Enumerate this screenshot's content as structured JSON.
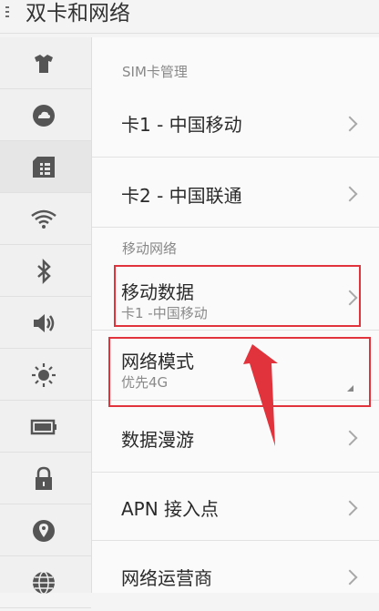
{
  "header": {
    "title": "双卡和网络"
  },
  "sidebar": {
    "items": [
      {
        "icon": "shirt-icon"
      },
      {
        "icon": "cloud-icon"
      },
      {
        "icon": "sim-card-icon",
        "selected": true
      },
      {
        "icon": "wifi-icon"
      },
      {
        "icon": "bluetooth-icon"
      },
      {
        "icon": "volume-icon"
      },
      {
        "icon": "brightness-icon"
      },
      {
        "icon": "battery-icon"
      },
      {
        "icon": "lock-icon"
      },
      {
        "icon": "location-icon"
      },
      {
        "icon": "globe-icon"
      }
    ]
  },
  "sections": {
    "sim": "SIM卡管理",
    "mobile": "移动网络"
  },
  "rows": {
    "card1": "卡1 - 中国移动",
    "card2": "卡2 - 中国联通",
    "mobile_data": {
      "label": "移动数据",
      "sub": "卡1 -中国移动"
    },
    "network_mode": {
      "label": "网络模式",
      "sub": "优先4G"
    },
    "roaming": "数据漫游",
    "apn": "APN 接入点",
    "operator": "网络运营商"
  },
  "colors": {
    "highlight": "#e0333b",
    "accent_text": "#2a2a2a"
  }
}
